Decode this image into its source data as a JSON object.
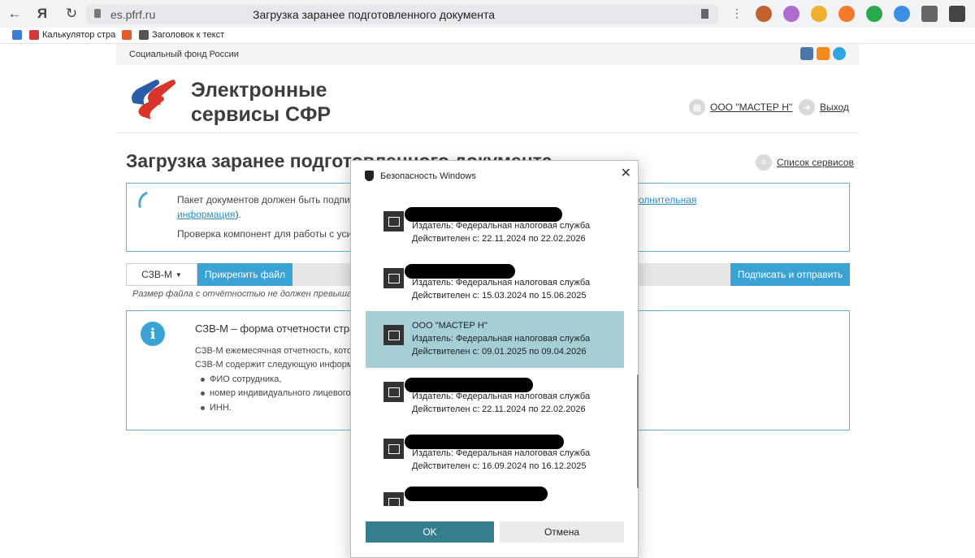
{
  "browser": {
    "url": "es.pfrf.ru",
    "tab_title": "Загрузка заранее подготовленного документа",
    "bookmarks": [
      "Калькулятор стра",
      "Заголовок к текст"
    ]
  },
  "site": {
    "fund_name": "Социальный фонд России",
    "brand_line1": "Электронные",
    "brand_line2": "сервисы СФР",
    "user": "ООО \"МАСТЕР Н\"",
    "logout": "Выход",
    "page_title": "Загрузка заранее подготовленного документа",
    "services_link": "Список сервисов",
    "notice_line1": "Пакет документов должен быть подпис",
    "notice_link_tail": "олнительная",
    "notice_link": "информация",
    "notice_link_after": ").",
    "notice_line3": "Проверка компонент для работы с усиленн",
    "form_select": "СЗВ-М",
    "attach_button": "Прикрепить файл",
    "send_button": "Подписать и отправить",
    "size_note": "Размер файла с отчётностью не должен превышать 1",
    "info_heading": "СЗВ-М – форма отчетности страхов",
    "info_line1": "СЗВ-М ежемесячная отчетность, которую",
    "info_line2": "СЗВ-М содержит следующую информаци",
    "bullets": [
      "ФИО сотрудника,",
      "номер индивидуального лицевого",
      "ИНН."
    ]
  },
  "dialog": {
    "title": "Безопасность Windows",
    "ok": "OK",
    "cancel": "Отмена",
    "certs": [
      {
        "name": "",
        "issuer": "Издатель: Федеральная налоговая служба",
        "valid": "Действителен с: 22.11.2024 по 22.02.2026",
        "selected": false
      },
      {
        "name": "",
        "issuer": "Издатель: Федеральная налоговая служба",
        "valid": "Действителен с: 15.03.2024 по 15.06.2025",
        "selected": false
      },
      {
        "name": "ООО \"МАСТЕР Н\"",
        "issuer": "Издатель: Федеральная налоговая служба",
        "valid": "Действителен с: 09.01.2025 по 09.04.2026",
        "selected": true
      },
      {
        "name": "",
        "issuer": "Издатель: Федеральная налоговая служба",
        "valid": "Действителен с: 22.11.2024 по 22.02.2026",
        "selected": false
      },
      {
        "name": "",
        "issuer": "Издатель: Федеральная налоговая служба",
        "valid": "Действителен с: 16.09.2024 по 16.12.2025",
        "selected": false
      },
      {
        "name": "",
        "issuer": "",
        "valid": "",
        "selected": false
      }
    ]
  }
}
